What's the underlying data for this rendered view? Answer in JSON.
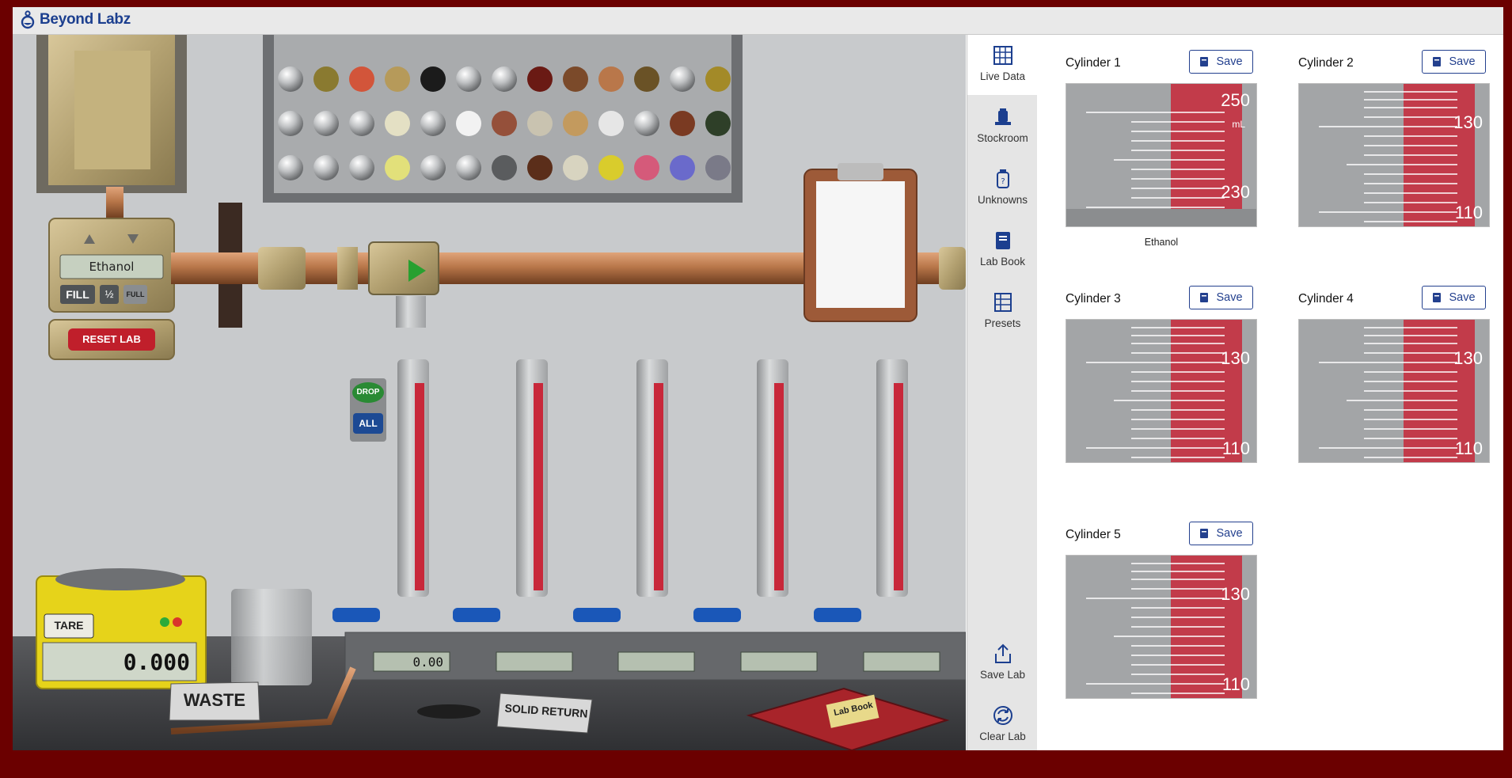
{
  "app": {
    "brand": "Beyond Labz"
  },
  "dispenser": {
    "display": "Ethanol",
    "buttons": {
      "fill": "FILL",
      "half": "½",
      "full": "FULL",
      "reset": "RESET LAB"
    }
  },
  "drop_controls": {
    "drop": "DROP",
    "all": "ALL"
  },
  "balance": {
    "tare": "TARE",
    "reading": "0.000"
  },
  "labels": {
    "waste": "WASTE",
    "solid_return": "SOLID RETURN",
    "lab_book": "Lab Book"
  },
  "station_readouts": [
    "0.00",
    "",
    "",
    "",
    ""
  ],
  "sidebar": {
    "items": [
      {
        "label": "Live Data",
        "icon": "grid-icon",
        "active": true
      },
      {
        "label": "Stockroom",
        "icon": "bottle-icon"
      },
      {
        "label": "Unknowns",
        "icon": "question-jar-icon"
      },
      {
        "label": "Lab Book",
        "icon": "book-icon"
      },
      {
        "label": "Presets",
        "icon": "list-icon"
      }
    ],
    "bottom": [
      {
        "label": "Save Lab",
        "icon": "share-icon"
      },
      {
        "label": "Clear Lab",
        "icon": "refresh-icon"
      }
    ]
  },
  "cylinders": [
    {
      "title": "Cylinder 1",
      "save": "Save",
      "scale_top": "250",
      "scale_bottom": "230",
      "unit": "mL",
      "liquid": "Ethanol"
    },
    {
      "title": "Cylinder 2",
      "save": "Save",
      "scale_top": "130",
      "scale_bottom": "110"
    },
    {
      "title": "Cylinder 3",
      "save": "Save",
      "scale_top": "130",
      "scale_bottom": "110"
    },
    {
      "title": "Cylinder 4",
      "save": "Save",
      "scale_top": "130",
      "scale_bottom": "110"
    },
    {
      "title": "Cylinder 5",
      "save": "Save",
      "scale_top": "130",
      "scale_bottom": "110"
    }
  ],
  "colors": {
    "brand": "#1c3f8f",
    "accent_red": "#c8283a",
    "background": "#6b0000",
    "copper": "#b9774a"
  }
}
